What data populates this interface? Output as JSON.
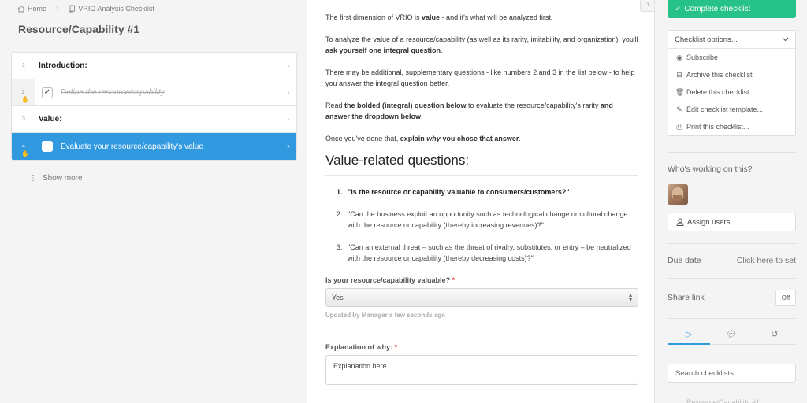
{
  "breadcrumb": [
    {
      "icon": "home-icon",
      "label": "Home"
    },
    {
      "icon": "checklist-icon",
      "label": "VRIO Analysis Checklist"
    }
  ],
  "page_title": "Resource/Capability #1",
  "tasks": [
    {
      "num": "1",
      "label": "Introduction:",
      "type": "heading"
    },
    {
      "num": "2",
      "label": "Define the resource/capability",
      "type": "subtask",
      "checked": true
    },
    {
      "num": "3",
      "label": "Value:",
      "type": "heading"
    },
    {
      "num": "4",
      "label": "Evaluate your resource/capability's value",
      "type": "subtask",
      "checked": false,
      "active": true
    }
  ],
  "show_more": "Show more",
  "main": {
    "p1": {
      "a": "The first dimension of VRIO is ",
      "b": "value",
      "c": " - and it's what will be analyzed first."
    },
    "p2": {
      "a": "To analyze the value of a resource/capability (as well as its rarity, imitability, and organization), you'll ",
      "b": "ask yourself one integral question",
      "c": "."
    },
    "p3": "There may be additional, supplementary questions - like numbers 2 and 3 in the list below - to help you answer the integral question better.",
    "p4": {
      "a": "Read ",
      "b": "the bolded (integral) question below",
      "c": " to evaluate the resource/capability's rarity ",
      "d": "and answer the dropdown below",
      "e": "."
    },
    "p5": {
      "a": "Once you've done that, ",
      "b": "explain ",
      "c": "why",
      "d": " you chose that answer",
      "e": "."
    },
    "heading": "Value-related questions:",
    "questions": [
      {
        "n": "1.",
        "text": "\"Is the resource or capability valuable to consumers/customers?\""
      },
      {
        "n": "2.",
        "text": "\"Can the business exploit an opportunity such as technological change or cultural change with the resource or capability (thereby increasing revenues)?\""
      },
      {
        "n": "3.",
        "text": "\"Can an external threat – such as the threat of rivalry, substitutes, or entry – be neutralized with the resource or capability (thereby decreasing costs)?\""
      }
    ],
    "dropdown_label": "Is your resource/capability valuable?",
    "dropdown_value": "Yes",
    "updated_text": "Updated by Manager a few seconds ago",
    "explanation_label": "Explanation of why:",
    "explanation_value": "Explanation here...",
    "required_mark": "*"
  },
  "sidebar": {
    "complete_label": "Complete checklist",
    "options_label": "Checklist options...",
    "options": [
      {
        "icon": "eye-icon",
        "glyph": "◉",
        "label": "Subscribe"
      },
      {
        "icon": "archive-icon",
        "glyph": "⊟",
        "label": "Archive this checklist"
      },
      {
        "icon": "trash-icon",
        "glyph": "🗑",
        "label": "Delete this checklist..."
      },
      {
        "icon": "pencil-icon",
        "glyph": "✎",
        "label": "Edit checklist template..."
      },
      {
        "icon": "print-icon",
        "glyph": "⎙",
        "label": "Print this checklist..."
      }
    ],
    "working_title": "Who's working on this?",
    "assign_label": "Assign users...",
    "due_label": "Due date",
    "due_link": "Click here to set",
    "share_label": "Share link",
    "share_value": "Off",
    "search_placeholder": "Search checklists",
    "footer_faint": "Resource/Capability #1"
  }
}
